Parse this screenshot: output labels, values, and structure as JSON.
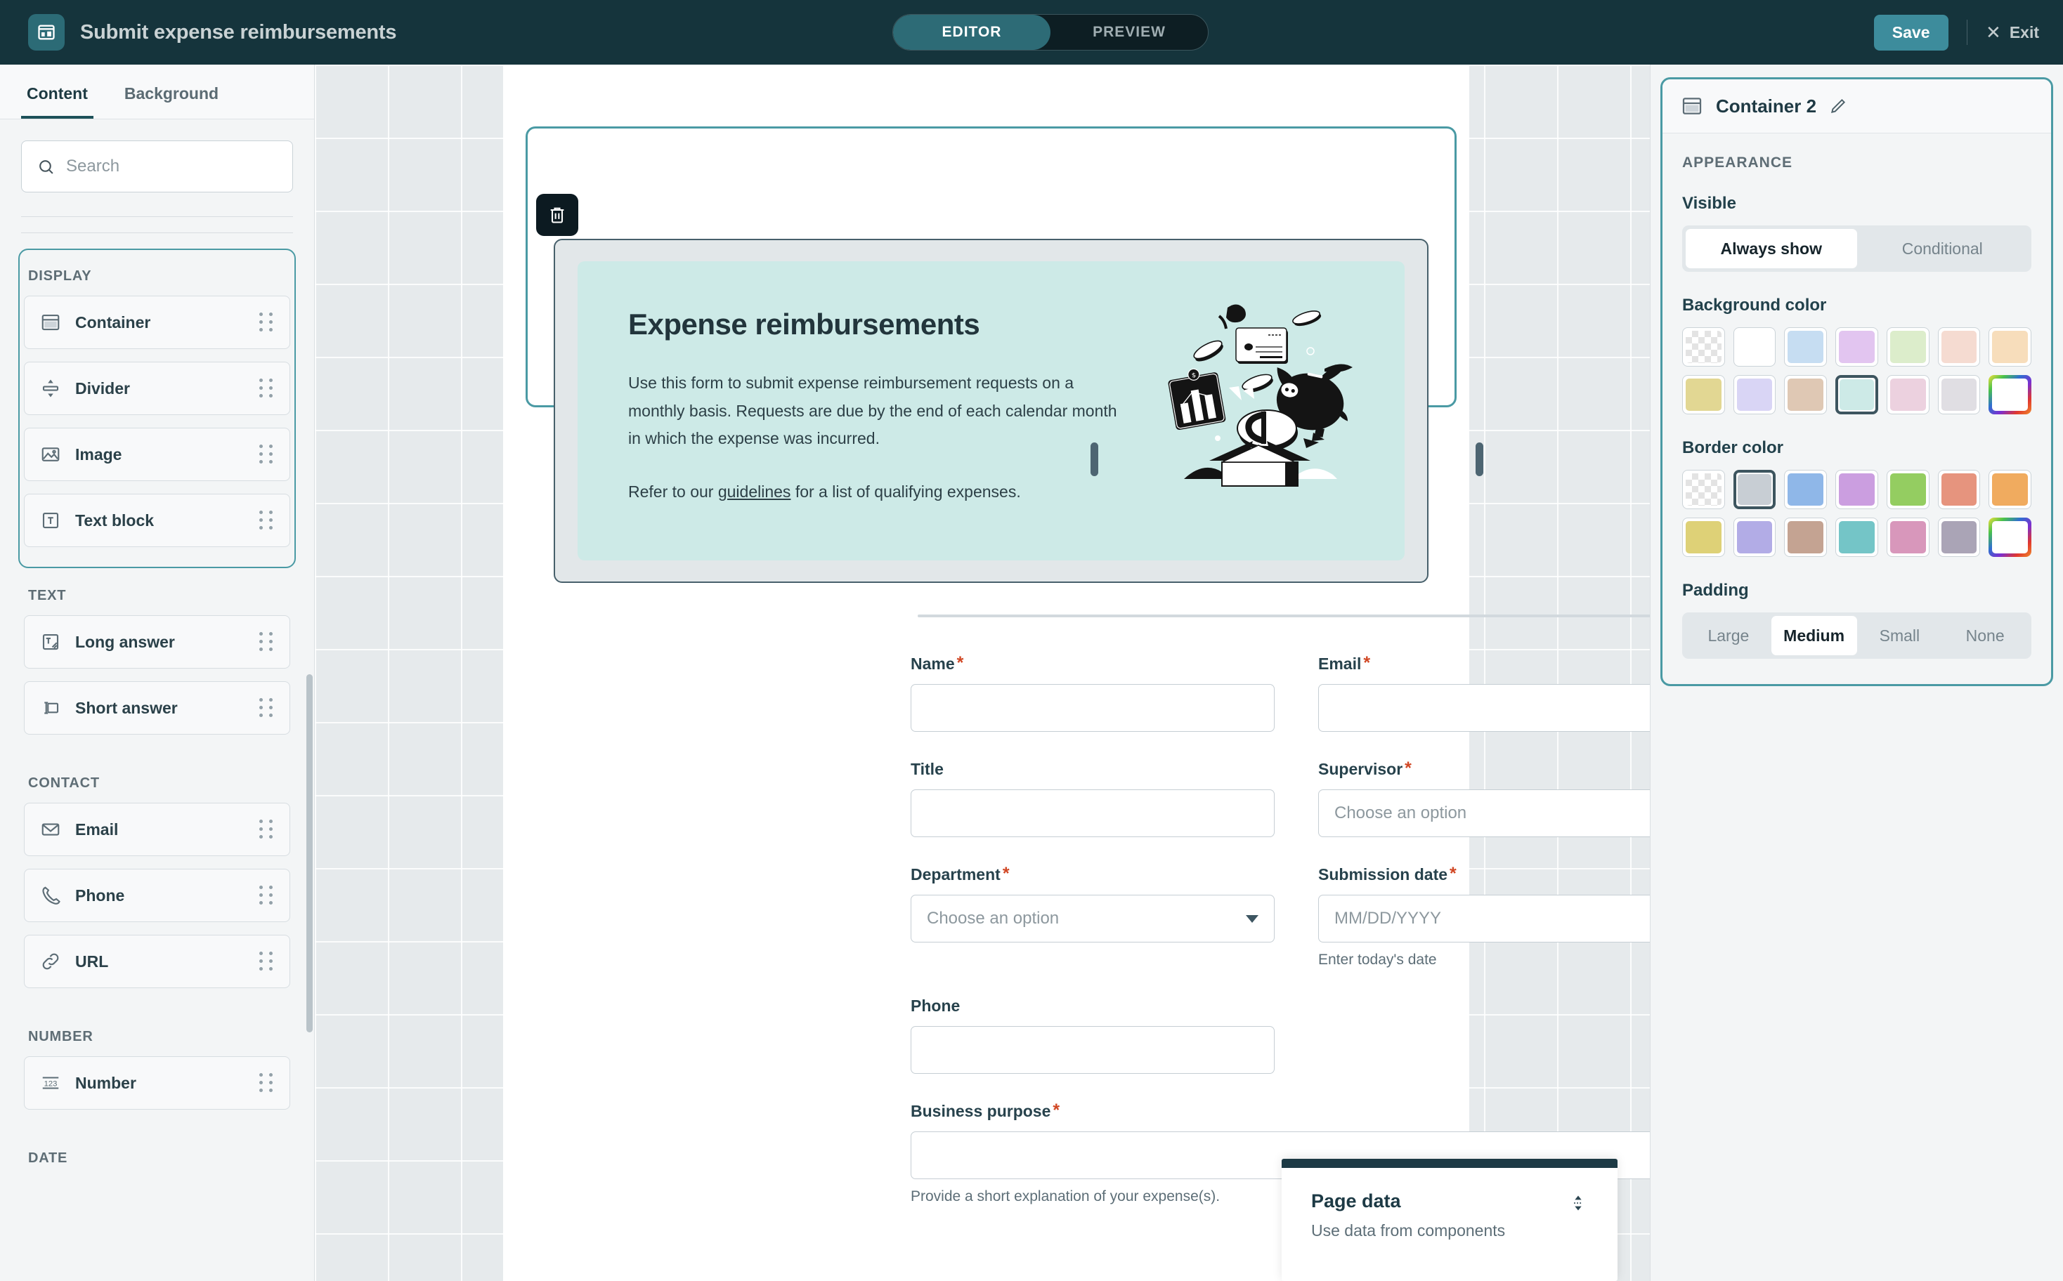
{
  "topbar": {
    "app_icon": "app-window-icon",
    "title": "Submit expense reimbursements",
    "modes": [
      {
        "label": "EDITOR",
        "active": true
      },
      {
        "label": "PREVIEW",
        "active": false
      }
    ],
    "save_label": "Save",
    "exit_label": "Exit",
    "exit_icon": "close-x-icon",
    "accent_color": "#3d8c9c",
    "bar_color": "#15343c"
  },
  "left_panel": {
    "tabs": [
      {
        "label": "Content",
        "active": true
      },
      {
        "label": "Background",
        "active": false
      }
    ],
    "search": {
      "placeholder": "Search",
      "value": "",
      "icon": "search-icon"
    },
    "groups": [
      {
        "title": "DISPLAY",
        "highlighted": true,
        "items": [
          {
            "label": "Container",
            "icon": "container-icon"
          },
          {
            "label": "Divider",
            "icon": "divider-icon"
          },
          {
            "label": "Image",
            "icon": "image-icon"
          },
          {
            "label": "Text block",
            "icon": "text-block-icon"
          }
        ]
      },
      {
        "title": "TEXT",
        "highlighted": false,
        "items": [
          {
            "label": "Long answer",
            "icon": "long-answer-icon"
          },
          {
            "label": "Short answer",
            "icon": "short-answer-icon"
          }
        ]
      },
      {
        "title": "CONTACT",
        "highlighted": false,
        "items": [
          {
            "label": "Email",
            "icon": "envelope-icon"
          },
          {
            "label": "Phone",
            "icon": "phone-icon"
          },
          {
            "label": "URL",
            "icon": "link-icon"
          }
        ]
      },
      {
        "title": "NUMBER",
        "highlighted": false,
        "items": [
          {
            "label": "Number",
            "icon": "number-123-icon"
          }
        ]
      },
      {
        "title": "DATE",
        "highlighted": false,
        "items": []
      }
    ]
  },
  "canvas": {
    "delete_icon": "trash-icon",
    "hero": {
      "title": "Expense reimbursements",
      "paragraph": "Use this form to submit expense reimbursement requests on a monthly basis. Requests are due by the end of each calendar month in which the expense was incurred.",
      "footer_prefix": "Refer to our ",
      "footer_link": "guidelines",
      "footer_suffix": " for a list of qualifying expenses.",
      "background_color": "#cdeae7",
      "illustration": "expense-illustration"
    },
    "form": {
      "fields": [
        {
          "label": "Name",
          "required": true,
          "type": "text",
          "value": "",
          "placeholder": "",
          "help": ""
        },
        {
          "label": "Email",
          "required": true,
          "type": "text",
          "value": "",
          "placeholder": "",
          "help": ""
        },
        {
          "label": "Title",
          "required": false,
          "type": "text",
          "value": "",
          "placeholder": "",
          "help": ""
        },
        {
          "label": "Supervisor",
          "required": true,
          "type": "select",
          "value": "",
          "placeholder": "Choose an option",
          "help": ""
        },
        {
          "label": "Department",
          "required": true,
          "type": "select",
          "value": "",
          "placeholder": "Choose an option",
          "help": ""
        },
        {
          "label": "Submission date",
          "required": true,
          "type": "date",
          "value": "",
          "placeholder": "MM/DD/YYYY",
          "help": "Enter today's date"
        },
        {
          "label": "Phone",
          "required": false,
          "type": "text",
          "value": "",
          "placeholder": "",
          "help": ""
        },
        {
          "label": "Business purpose",
          "required": true,
          "type": "text",
          "value": "",
          "placeholder": "",
          "help": "Provide a short explanation of your expense(s)."
        }
      ]
    },
    "page_data_popup": {
      "title": "Page data",
      "subtitle": "Use data from components",
      "grip_icon": "drag-vertical-icon"
    }
  },
  "right_panel": {
    "header": {
      "icon": "container-icon",
      "title": "Container 2",
      "edit_icon": "pencil-icon"
    },
    "section_title": "APPEARANCE",
    "visible": {
      "label": "Visible",
      "options": [
        {
          "label": "Always show",
          "active": true
        },
        {
          "label": "Conditional",
          "active": false
        }
      ]
    },
    "background_color": {
      "label": "Background color",
      "swatches": [
        {
          "color": "transparent",
          "kind": "checker",
          "selected": false
        },
        {
          "color": "#ffffff",
          "kind": "solid",
          "selected": false
        },
        {
          "color": "#c6ddf2",
          "kind": "solid",
          "selected": false
        },
        {
          "color": "#e2c5f0",
          "kind": "solid",
          "selected": false
        },
        {
          "color": "#dcedcb",
          "kind": "solid",
          "selected": false
        },
        {
          "color": "#f5dbd1",
          "kind": "solid",
          "selected": false
        },
        {
          "color": "#f7ddbb",
          "kind": "solid",
          "selected": false
        },
        {
          "color": "#e2d793",
          "kind": "solid",
          "selected": false
        },
        {
          "color": "#d9d5f5",
          "kind": "solid",
          "selected": false
        },
        {
          "color": "#dfc8b4",
          "kind": "solid",
          "selected": false
        },
        {
          "color": "#cdeae7",
          "kind": "solid",
          "selected": true
        },
        {
          "color": "#ecd1df",
          "kind": "solid",
          "selected": false
        },
        {
          "color": "#e0dee3",
          "kind": "solid",
          "selected": false
        },
        {
          "color": "custom",
          "kind": "rainbow",
          "selected": false
        }
      ]
    },
    "border_color": {
      "label": "Border color",
      "swatches": [
        {
          "color": "transparent",
          "kind": "checker",
          "selected": false
        },
        {
          "color": "#c8ced4",
          "kind": "solid",
          "selected": true
        },
        {
          "color": "#8fb7e8",
          "kind": "solid",
          "selected": false
        },
        {
          "color": "#cb9ee0",
          "kind": "solid",
          "selected": false
        },
        {
          "color": "#94cd61",
          "kind": "solid",
          "selected": false
        },
        {
          "color": "#e6947e",
          "kind": "solid",
          "selected": false
        },
        {
          "color": "#f0ab5f",
          "kind": "solid",
          "selected": false
        },
        {
          "color": "#ded177",
          "kind": "solid",
          "selected": false
        },
        {
          "color": "#b2ace6",
          "kind": "solid",
          "selected": false
        },
        {
          "color": "#c4a392",
          "kind": "solid",
          "selected": false
        },
        {
          "color": "#74c5c7",
          "kind": "solid",
          "selected": false
        },
        {
          "color": "#d897bb",
          "kind": "solid",
          "selected": false
        },
        {
          "color": "#aaa4b6",
          "kind": "solid",
          "selected": false
        },
        {
          "color": "custom",
          "kind": "rainbow",
          "selected": false
        }
      ]
    },
    "padding": {
      "label": "Padding",
      "options": [
        {
          "label": "Large",
          "active": false
        },
        {
          "label": "Medium",
          "active": true
        },
        {
          "label": "Small",
          "active": false
        },
        {
          "label": "None",
          "active": false
        }
      ]
    }
  }
}
